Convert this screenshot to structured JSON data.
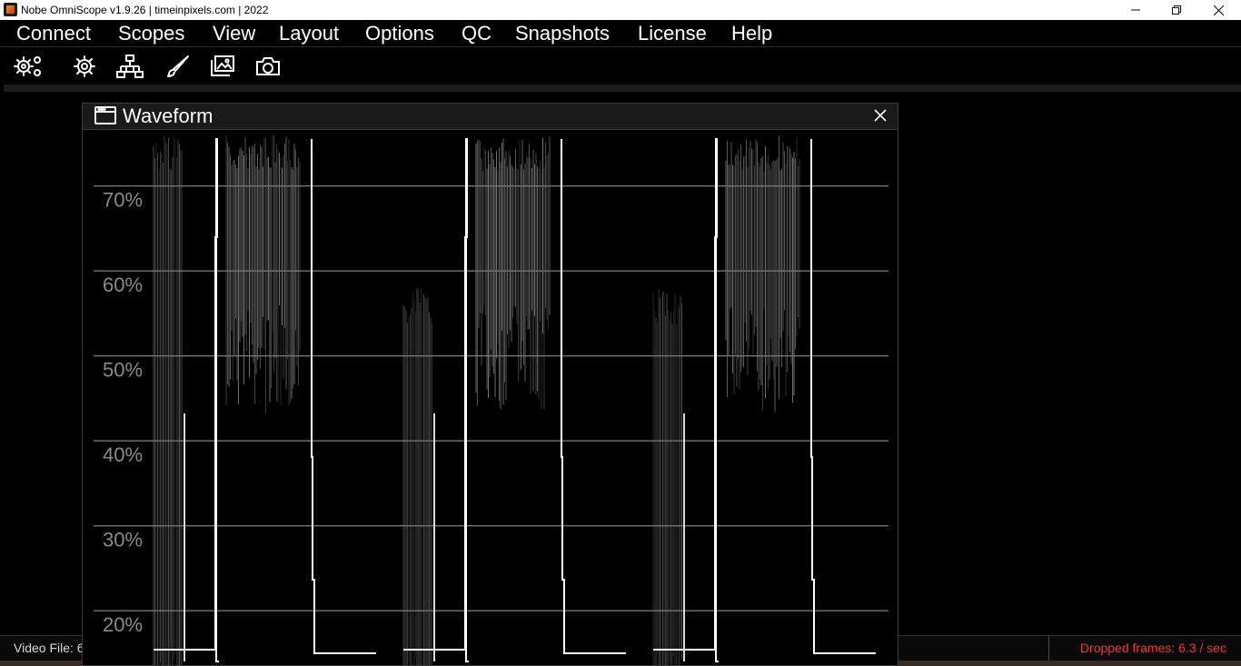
{
  "window": {
    "title": "Nobe OmniScope v1.9.26 | timeinpixels.com | 2022",
    "controls": {
      "minimize": "—",
      "restore": "❐",
      "close": "✕"
    }
  },
  "menu": [
    "Connect",
    "Scopes",
    "View",
    "Layout",
    "Options",
    "QC",
    "Snapshots",
    "License",
    "Help"
  ],
  "toolbar": {
    "icons": [
      "gears-icon",
      "gear-icon",
      "network-icon",
      "brush-icon",
      "images-icon",
      "camera-icon"
    ]
  },
  "panel": {
    "title": "Waveform",
    "close_label": "×"
  },
  "waveform": {
    "scale_labels": [
      "70%",
      "60%",
      "50%",
      "40%",
      "30%",
      "20%"
    ],
    "scale_values": [
      70,
      60,
      50,
      40,
      30,
      20
    ],
    "visible_range": [
      13.6,
      76.6
    ]
  },
  "status": {
    "left": "Video File: 6",
    "right": "Dropped frames: 6.3 / sec"
  },
  "colors": {
    "background": "#000000",
    "graticule": "#6f7674",
    "trace": "#ffffff",
    "dropped_frames": "#ff3030"
  }
}
